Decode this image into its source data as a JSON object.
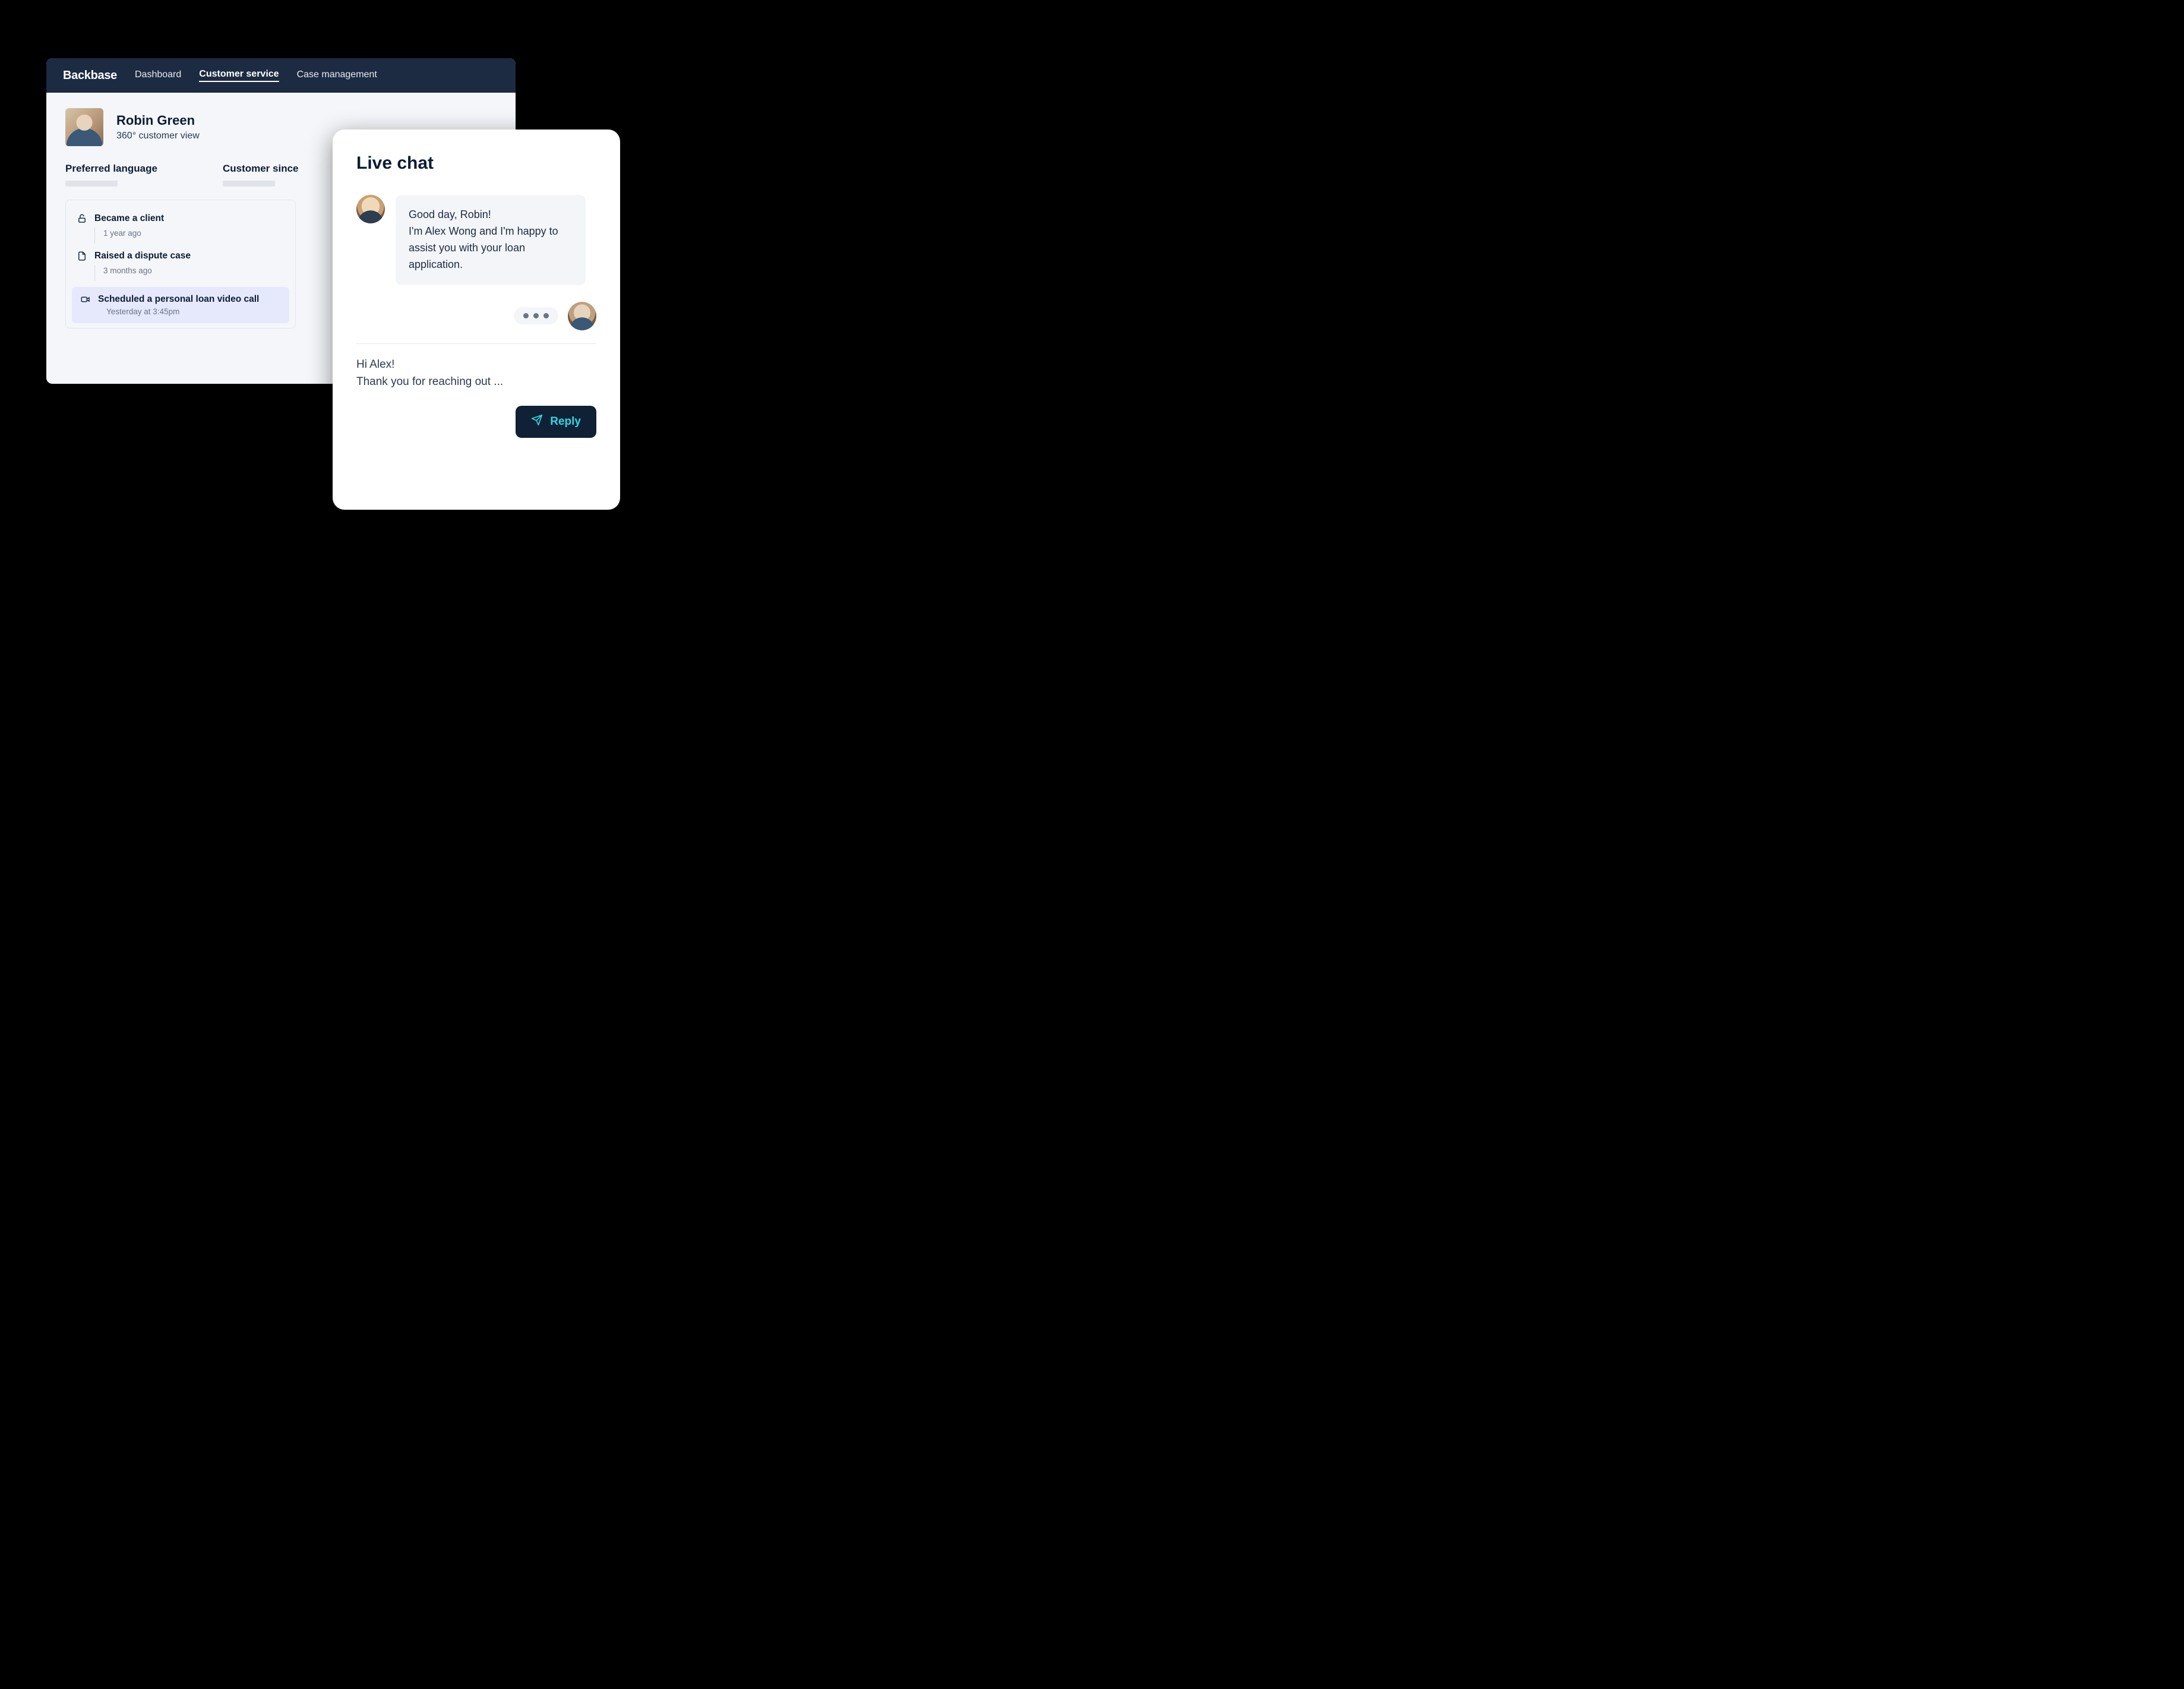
{
  "brand": "Backbase",
  "nav": {
    "items": [
      {
        "label": "Dashboard",
        "active": false
      },
      {
        "label": "Customer service",
        "active": true
      },
      {
        "label": "Case management",
        "active": false
      }
    ]
  },
  "customer": {
    "name": "Robin Green",
    "subtitle": "360° customer view",
    "meta": {
      "preferred_language_label": "Preferred language",
      "customer_since_label": "Customer since"
    }
  },
  "timeline": [
    {
      "icon": "unlock-icon",
      "title": "Became a client",
      "time": "1 year ago",
      "highlight": false
    },
    {
      "icon": "file-icon",
      "title": "Raised a dispute case",
      "time": "3 months ago",
      "highlight": false
    },
    {
      "icon": "video-icon",
      "title": "Scheduled a personal loan video call",
      "time": "Yesterday at 3:45pm",
      "highlight": true
    }
  ],
  "chat": {
    "title": "Live chat",
    "agent_message": "Good day, Robin!\nI'm Alex Wong and I'm happy to assist you with your loan application.",
    "draft": "Hi Alex!\nThank you for reaching out ...",
    "reply_label": "Reply"
  }
}
